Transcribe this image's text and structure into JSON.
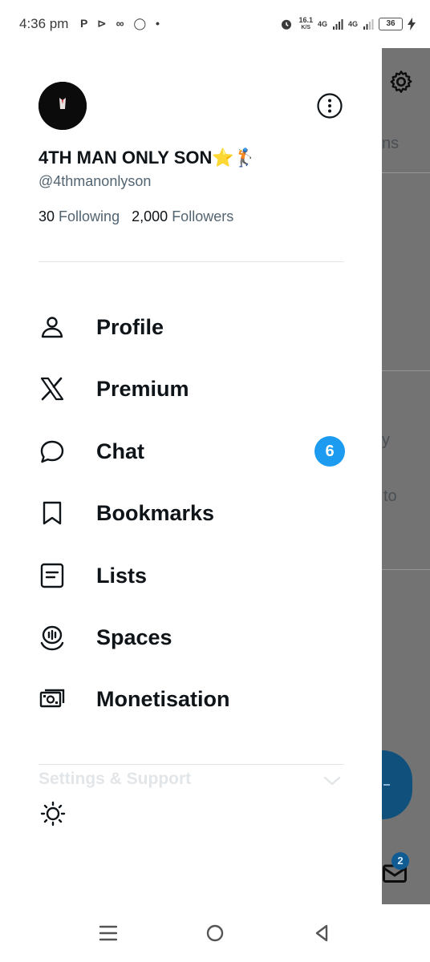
{
  "status_bar": {
    "time": "4:36 pm",
    "notification_icons": "P ⊳ ∞ ◯ •",
    "net_speed_value": "16.1",
    "net_speed_unit": "K/S",
    "signal_1": "4G",
    "signal_2": "4G",
    "battery": "36"
  },
  "background": {
    "partial_text_1": "ns",
    "partial_text_2": "y",
    "partial_text_3": "to",
    "mail_badge": "2"
  },
  "profile": {
    "display_name": "4TH MAN ONLY SON⭐🏌",
    "handle": "@4thmanonlyson",
    "following_count": "30",
    "following_label": "Following",
    "followers_count": "2,000",
    "followers_label": "Followers"
  },
  "menu": {
    "items": [
      {
        "label": "Profile",
        "icon": "person-icon"
      },
      {
        "label": "Premium",
        "icon": "x-logo-icon"
      },
      {
        "label": "Chat",
        "icon": "chat-bubble-icon",
        "badge": "6"
      },
      {
        "label": "Bookmarks",
        "icon": "bookmark-icon"
      },
      {
        "label": "Lists",
        "icon": "list-icon"
      },
      {
        "label": "Spaces",
        "icon": "spaces-icon"
      },
      {
        "label": "Monetisation",
        "icon": "money-icon"
      }
    ]
  },
  "settings": {
    "label": "Settings & Support"
  },
  "colors": {
    "accent": "#1d9bf0",
    "text_primary": "#0f1419",
    "text_secondary": "#536471"
  }
}
